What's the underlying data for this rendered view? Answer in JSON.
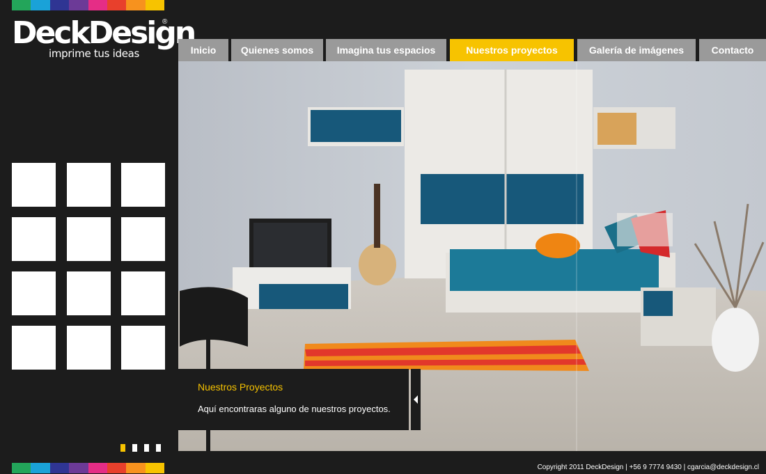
{
  "brand": {
    "name": "DeckDesign",
    "registered": "®",
    "tagline": "imprime tus ideas",
    "stripe_colors": [
      "#23a55a",
      "#1aa2d8",
      "#2f3593",
      "#6c3a97",
      "#e52d86",
      "#e8402c",
      "#f7921e",
      "#f7c300"
    ]
  },
  "nav": {
    "items": [
      {
        "label": "Inicio",
        "active": false
      },
      {
        "label": "Quienes somos",
        "active": false
      },
      {
        "label": "Imagina tus espacios",
        "active": false
      },
      {
        "label": "Nuestros proyectos",
        "active": true
      },
      {
        "label": "Galería de imágenes",
        "active": false
      },
      {
        "label": "Contacto",
        "active": false
      }
    ]
  },
  "thumbnails": {
    "count": 12
  },
  "slider": {
    "total": 4,
    "active": 1
  },
  "caption": {
    "title": "Nuestros Proyectos",
    "text": "Aquí encontraras alguno de nuestros proyectos."
  },
  "footer": {
    "text": "Copyright 2011 DeckDesign | +56 9 7774 9430 | cgarcia@deckdesign.cl"
  },
  "colors": {
    "accent": "#f7c300",
    "nav_bg": "#9a9a9a",
    "page_bg": "#1c1c1c"
  }
}
